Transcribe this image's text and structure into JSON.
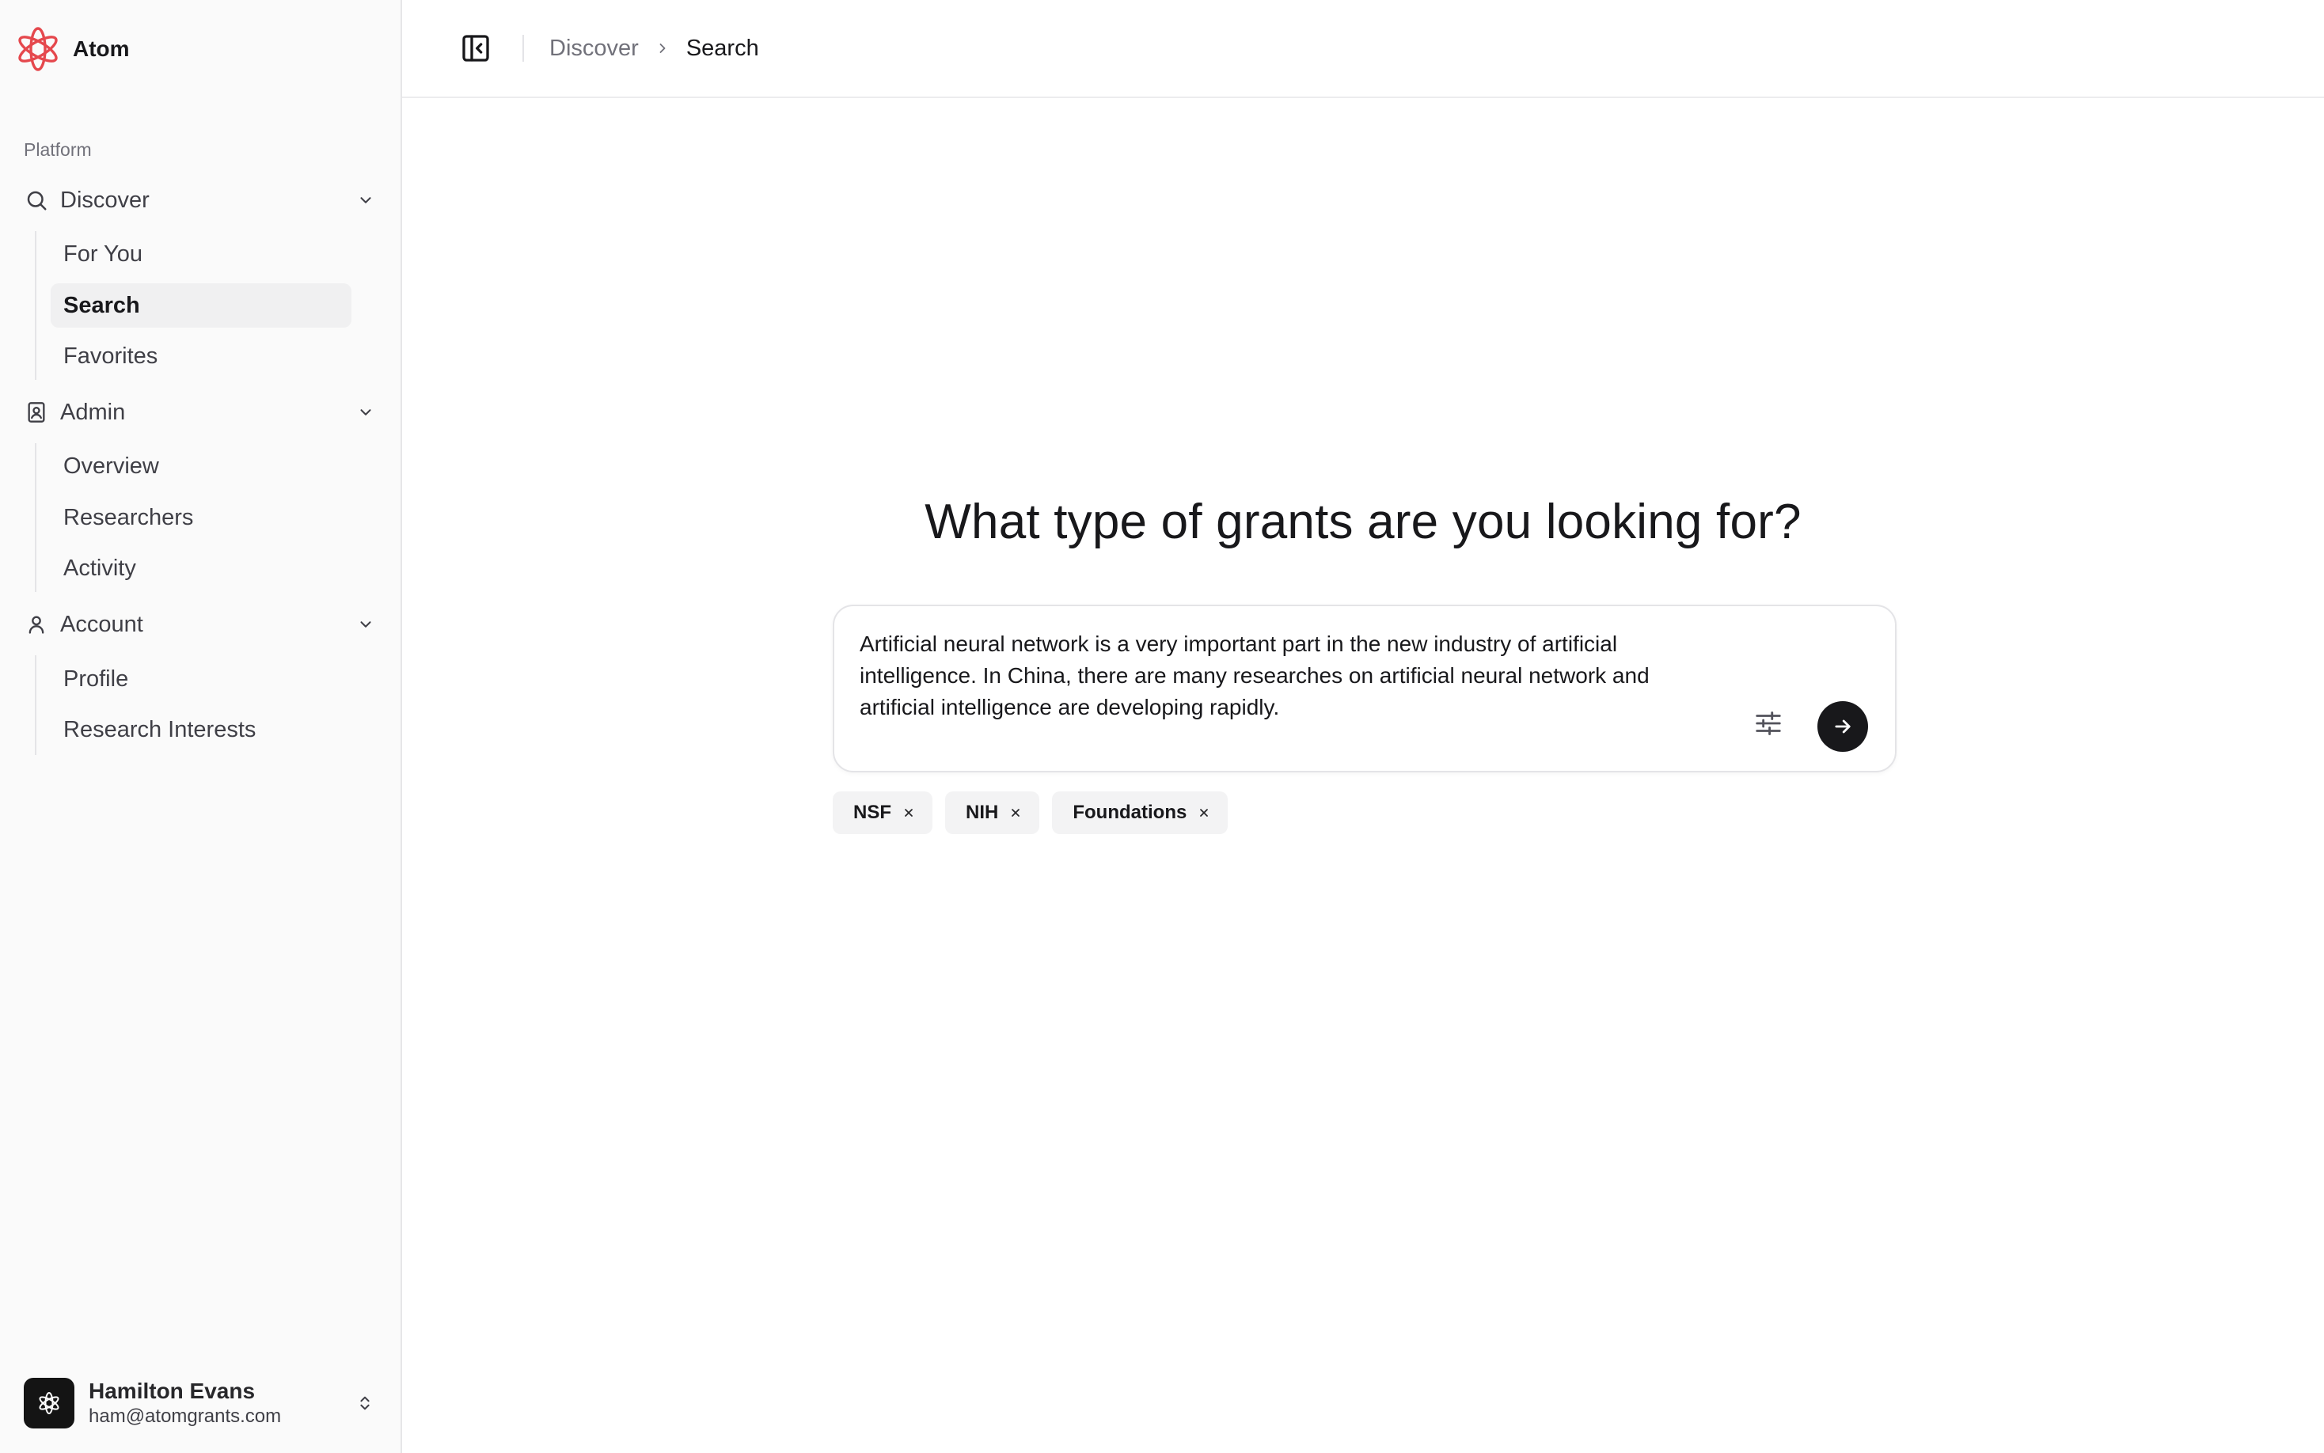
{
  "brand": {
    "name": "Atom",
    "accent": "#e5484d"
  },
  "sidebar": {
    "group_label": "Platform",
    "sections": [
      {
        "label": "Discover",
        "icon": "search-icon",
        "items": [
          {
            "label": "For You"
          },
          {
            "label": "Search",
            "active": true
          },
          {
            "label": "Favorites"
          }
        ]
      },
      {
        "label": "Admin",
        "icon": "contact-book-icon",
        "items": [
          {
            "label": "Overview"
          },
          {
            "label": "Researchers"
          },
          {
            "label": "Activity"
          }
        ]
      },
      {
        "label": "Account",
        "icon": "user-icon",
        "items": [
          {
            "label": "Profile"
          },
          {
            "label": "Research Interests"
          }
        ]
      }
    ]
  },
  "user": {
    "name": "Hamilton Evans",
    "email": "ham@atomgrants.com"
  },
  "breadcrumb": {
    "parent": "Discover",
    "current": "Search"
  },
  "main": {
    "headline": "What type of grants are you looking for?",
    "query": "Artificial neural network is a very important part in the new industry of artificial intelligence. In China, there are many researches on artificial neural network and artificial intelligence are developing rapidly.",
    "filters": [
      "NSF",
      "NIH",
      "Foundations"
    ]
  }
}
